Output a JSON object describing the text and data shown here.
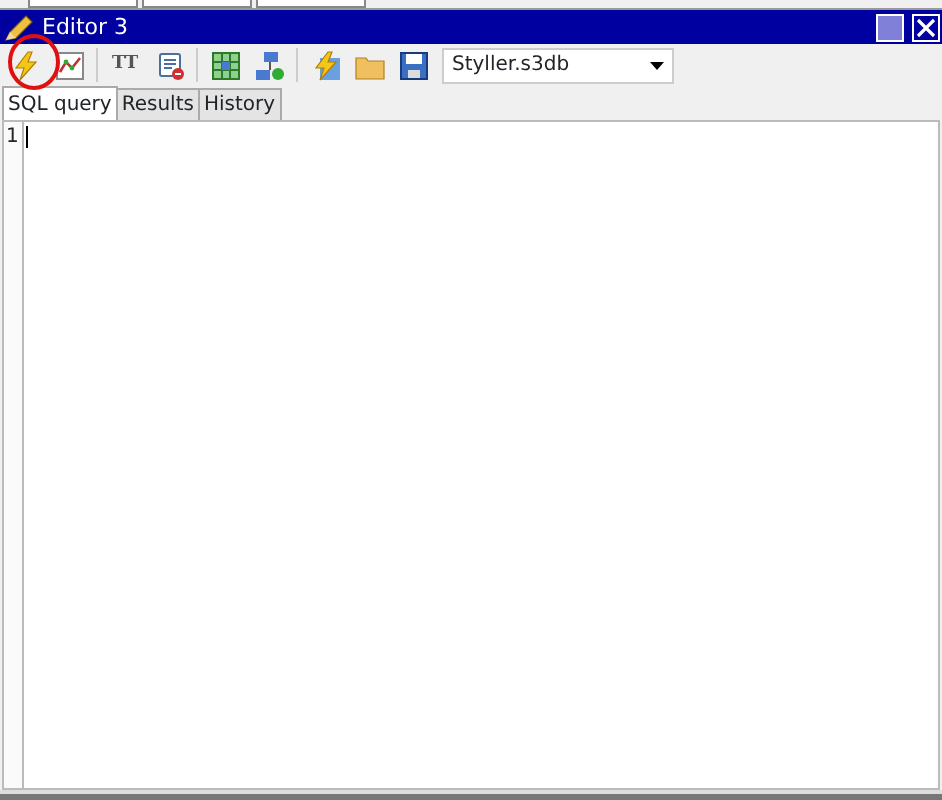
{
  "window": {
    "title": "Editor 3"
  },
  "toolbar": {
    "text_button": "TT",
    "database": "Styller.s3db"
  },
  "tabs": [
    {
      "label": "SQL query",
      "selected": true
    },
    {
      "label": "Results",
      "selected": false
    },
    {
      "label": "History",
      "selected": false
    }
  ],
  "editor": {
    "line_numbers": [
      "1"
    ]
  }
}
